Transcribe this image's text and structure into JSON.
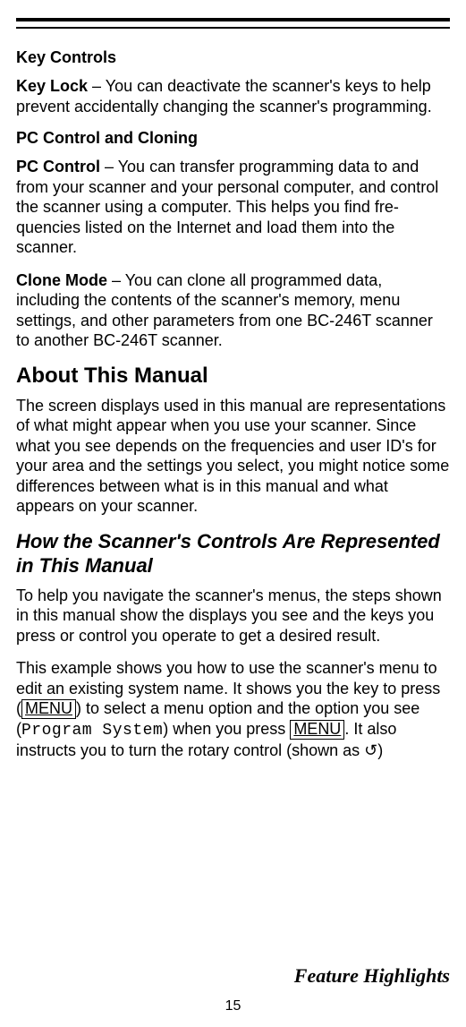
{
  "sections": {
    "keyControls": {
      "heading": "Key Controls",
      "keyLock": {
        "label": "Key Lock",
        "text": " – You can deactivate the scanner's keys to help prevent accidentally changing the scanner's pro­gramming."
      }
    },
    "pcControl": {
      "heading": "PC Control and Cloning",
      "item": {
        "label": "PC Control",
        "text": " – You can transfer programming data to and from your scanner and your personal computer, and con­trol the scanner using a computer. This helps you find fre­quencies listed on the Internet and load them into the scanner."
      },
      "clone": {
        "label": "Clone Mode",
        "text": " – You can clone all programmed data, including the contents of the scanner's memory, menu settings, and other parameters from one BC-246T scanner to another BC-246T scanner."
      }
    },
    "about": {
      "heading": "About This Manual",
      "text": "The screen displays used in this manual are representations of what might appear when you use your scanner. Since what you see depends on the frequencies and user ID's for your area and the settings you select, you might notice some differences between what is in this manual and what appears on your scanner."
    },
    "controlsRep": {
      "heading": "How the Scanner's Controls Are Represented in This Manual",
      "p1": "To help you navigate the scanner's menus, the steps shown in this manual show the displays you see and the keys you press or control you operate to get a desired result.",
      "p2a": "This example shows you how to use the scanner's menu to edit an existing system name. It shows you the key to press (",
      "key1": "MENU",
      "p2b": ") to select a menu option and the option you see (",
      "monoOption": "Program System",
      "p2c": ") when you press ",
      "key2": "MENU",
      "p2d": ". It also instructs you to turn the rotary control (shown as ",
      "rotary": "↺",
      "p2e": ")"
    }
  },
  "footer": {
    "title": "Feature Highlights",
    "page": "15"
  }
}
